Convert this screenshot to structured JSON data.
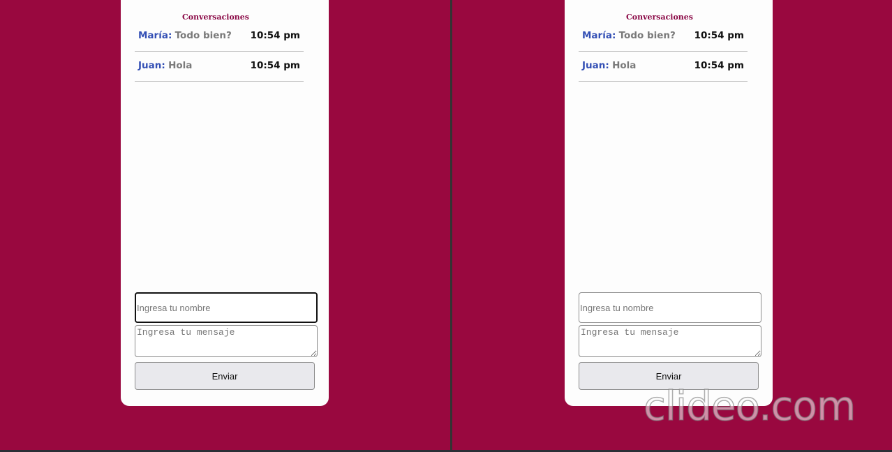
{
  "left_pane": {
    "title": "Conversaciones",
    "conversations": [
      {
        "name": "María:",
        "message": "Todo bien?",
        "time": "10:54 pm"
      },
      {
        "name": "Juan:",
        "message": "Hola",
        "time": "10:54 pm"
      }
    ],
    "name_placeholder": "Ingresa tu nombre",
    "message_placeholder": "Ingresa tu mensaje",
    "send_label": "Enviar"
  },
  "right_pane": {
    "title": "Conversaciones",
    "conversations": [
      {
        "name": "María:",
        "message": "Todo bien?",
        "time": "10:54 pm"
      },
      {
        "name": "Juan:",
        "message": "Hola",
        "time": "10:54 pm"
      }
    ],
    "name_placeholder": "Ingresa tu nombre",
    "message_placeholder": "Ingresa tu mensaje",
    "send_label": "Enviar"
  },
  "watermark": "clideo.com",
  "colors": {
    "background": "#99083f",
    "title": "#8b0a47",
    "sender_name": "#3450b5",
    "message_text": "#7a7a7a"
  }
}
